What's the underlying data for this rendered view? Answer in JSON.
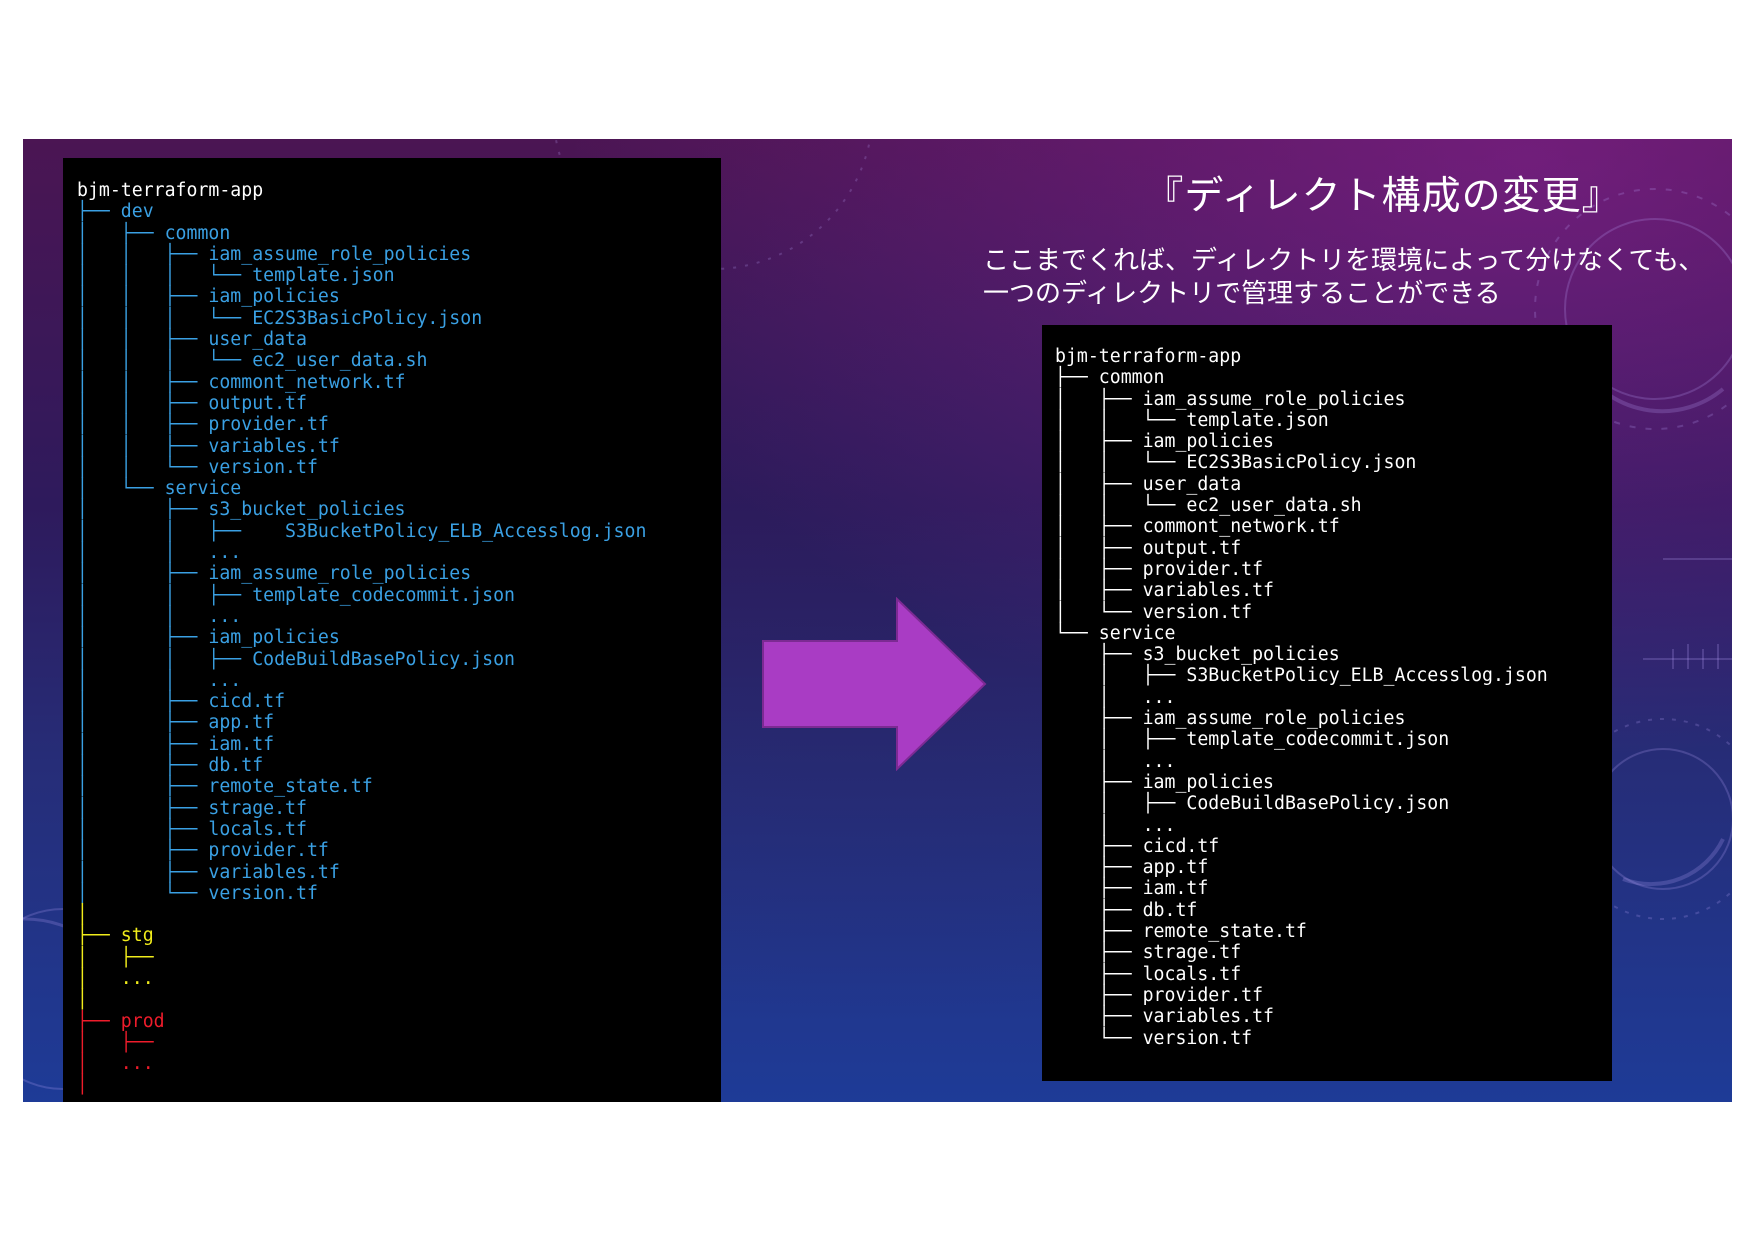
{
  "slide": {
    "title": "『ディレクト構成の変更』",
    "description": [
      "ここまでくれば、ディレクトリを環境によって分けなくても、",
      "一つのディレクトリで管理することができる"
    ],
    "colors": {
      "arrow": "#a93cc4",
      "tree_blue": "#3aa0e3",
      "tree_yellow": "#f1ec1b",
      "tree_red": "#ee1c2b",
      "terminal_bg": "#000000"
    }
  },
  "left_tree": [
    {
      "text": "bjm-terraform-app",
      "color": "white"
    },
    {
      "text": "├── dev",
      "color": "blue"
    },
    {
      "text": "│   ├── common",
      "color": "blue"
    },
    {
      "text": "│   │   ├── iam_assume_role_policies",
      "color": "blue"
    },
    {
      "text": "│   │   │   └── template.json",
      "color": "blue"
    },
    {
      "text": "│   │   ├── iam_policies",
      "color": "blue"
    },
    {
      "text": "│   │   │   └── EC2S3BasicPolicy.json",
      "color": "blue"
    },
    {
      "text": "│   │   ├── user_data",
      "color": "blue"
    },
    {
      "text": "│   │   │   └── ec2_user_data.sh",
      "color": "blue"
    },
    {
      "text": "│   │   ├── commont_network.tf",
      "color": "blue"
    },
    {
      "text": "│   │   ├── output.tf",
      "color": "blue"
    },
    {
      "text": "│   │   ├── provider.tf",
      "color": "blue"
    },
    {
      "text": "│   │   ├── variables.tf",
      "color": "blue"
    },
    {
      "text": "│   │   └── version.tf",
      "color": "blue"
    },
    {
      "text": "│   └── service",
      "color": "blue"
    },
    {
      "text": "│       ├── s3_bucket_policies",
      "color": "blue"
    },
    {
      "text": "│       │   ├──    S3BucketPolicy_ELB_Accesslog.json",
      "color": "blue"
    },
    {
      "text": "│       │   ...",
      "color": "blue"
    },
    {
      "text": "│       ├── iam_assume_role_policies",
      "color": "blue"
    },
    {
      "text": "│       │   ├── template_codecommit.json",
      "color": "blue"
    },
    {
      "text": "│       │   ...",
      "color": "blue"
    },
    {
      "text": "│       ├── iam_policies",
      "color": "blue"
    },
    {
      "text": "│       │   ├── CodeBuildBasePolicy.json",
      "color": "blue"
    },
    {
      "text": "│       │   ...",
      "color": "blue"
    },
    {
      "text": "│       ├── cicd.tf",
      "color": "blue"
    },
    {
      "text": "│       ├── app.tf",
      "color": "blue"
    },
    {
      "text": "│       ├── iam.tf",
      "color": "blue"
    },
    {
      "text": "│       ├── db.tf",
      "color": "blue"
    },
    {
      "text": "│       ├── remote_state.tf",
      "color": "blue"
    },
    {
      "text": "│       ├── strage.tf",
      "color": "blue"
    },
    {
      "text": "│       ├── locals.tf",
      "color": "blue"
    },
    {
      "text": "│       ├── provider.tf",
      "color": "blue"
    },
    {
      "text": "│       ├── variables.tf",
      "color": "blue"
    },
    {
      "text": "│       └── version.tf",
      "color": "blue"
    },
    {
      "text": "│",
      "color": "yellow"
    },
    {
      "text": "├── stg",
      "color": "yellow"
    },
    {
      "text": "│   ├──",
      "color": "yellow"
    },
    {
      "text": "│   ...",
      "color": "yellow"
    },
    {
      "text": "│",
      "color": "yellow"
    },
    {
      "text": "├── prod",
      "color": "red"
    },
    {
      "text": "│   ├──",
      "color": "red"
    },
    {
      "text": "│   ...",
      "color": "red"
    },
    {
      "text": "│",
      "color": "red"
    }
  ],
  "right_tree": [
    "bjm-terraform-app",
    "├── common",
    "│   ├── iam_assume_role_policies",
    "│   │   └── template.json",
    "│   ├── iam_policies",
    "│   │   └── EC2S3BasicPolicy.json",
    "│   ├── user_data",
    "│   │   └── ec2_user_data.sh",
    "│   ├── commont_network.tf",
    "│   ├── output.tf",
    "│   ├── provider.tf",
    "│   ├── variables.tf",
    "│   └── version.tf",
    "└── service",
    "    ├── s3_bucket_policies",
    "    │   ├── S3BucketPolicy_ELB_Accesslog.json",
    "    │   ...",
    "    ├── iam_assume_role_policies",
    "    │   ├── template_codecommit.json",
    "    │   ...",
    "    ├── iam_policies",
    "    │   ├── CodeBuildBasePolicy.json",
    "    │   ...",
    "    ├── cicd.tf",
    "    ├── app.tf",
    "    ├── iam.tf",
    "    ├── db.tf",
    "    ├── remote_state.tf",
    "    ├── strage.tf",
    "    ├── locals.tf",
    "    ├── provider.tf",
    "    ├── variables.tf",
    "    └── version.tf"
  ]
}
